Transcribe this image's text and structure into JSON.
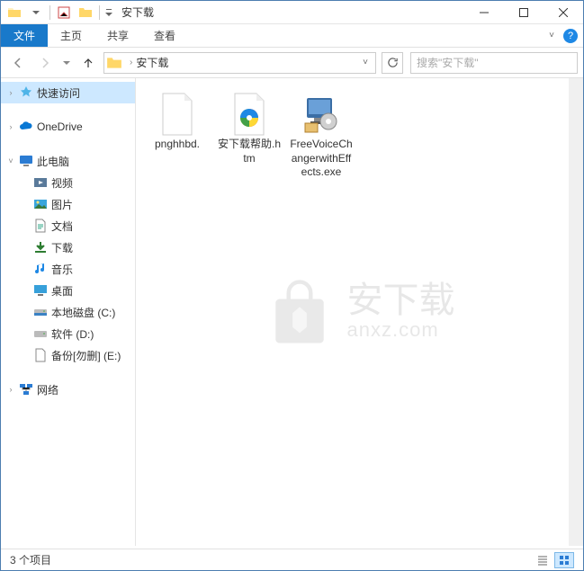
{
  "window": {
    "title": "安下载"
  },
  "ribbon": {
    "tabs": [
      "文件",
      "主页",
      "共享",
      "查看"
    ],
    "active_index": 0
  },
  "address": {
    "path": "安下载"
  },
  "search": {
    "placeholder": "搜索\"安下载\""
  },
  "sidebar": {
    "quick_access": "快速访问",
    "onedrive": "OneDrive",
    "this_pc": "此电脑",
    "videos": "视频",
    "pictures": "图片",
    "documents": "文档",
    "downloads": "下载",
    "music": "音乐",
    "desktop": "桌面",
    "drive_c": "本地磁盘 (C:)",
    "drive_d": "软件 (D:)",
    "drive_e": "备份[勿删] (E:)",
    "network": "网络"
  },
  "files": [
    {
      "name": "pnghhbd.",
      "type": "blank"
    },
    {
      "name": "安下载帮助.htm",
      "type": "htm"
    },
    {
      "name": "FreeVoiceChangerwithEffects.exe",
      "type": "exe"
    }
  ],
  "status": {
    "text": "3 个项目"
  },
  "watermark": {
    "cn": "安下载",
    "en": "anxz.com"
  }
}
